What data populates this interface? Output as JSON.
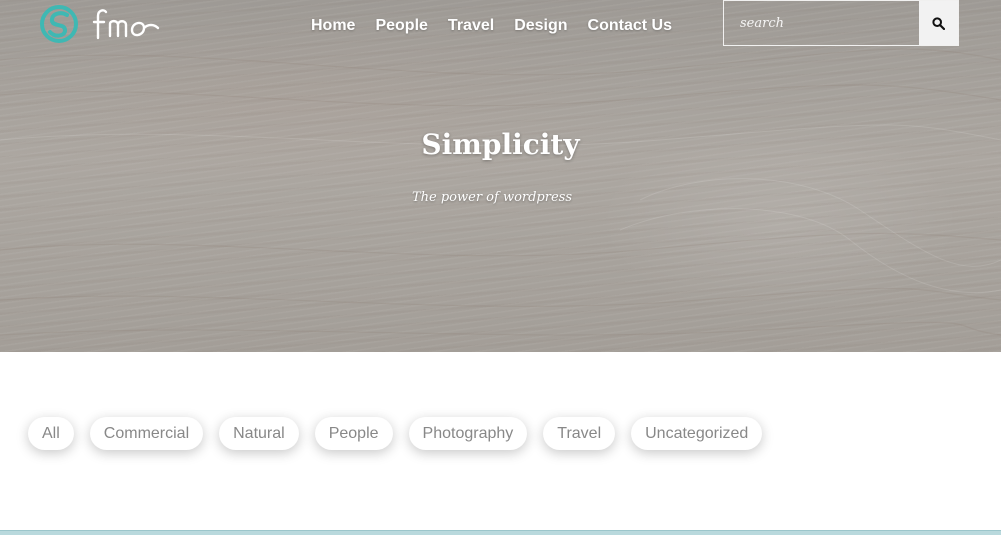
{
  "brand": {
    "logo_text": "fmo",
    "accent": "#3fb8b3"
  },
  "nav": {
    "items": [
      {
        "label": "Home"
      },
      {
        "label": "People"
      },
      {
        "label": "Travel"
      },
      {
        "label": "Design"
      },
      {
        "label": "Contact Us"
      }
    ]
  },
  "search": {
    "placeholder": "search",
    "icon": "search-icon"
  },
  "hero": {
    "title": "Simplicity",
    "subtitle": "The power of wordpress"
  },
  "filters": {
    "items": [
      {
        "label": "All"
      },
      {
        "label": "Commercial"
      },
      {
        "label": "Natural"
      },
      {
        "label": "People"
      },
      {
        "label": "Photography"
      },
      {
        "label": "Travel"
      },
      {
        "label": "Uncategorized"
      }
    ]
  }
}
